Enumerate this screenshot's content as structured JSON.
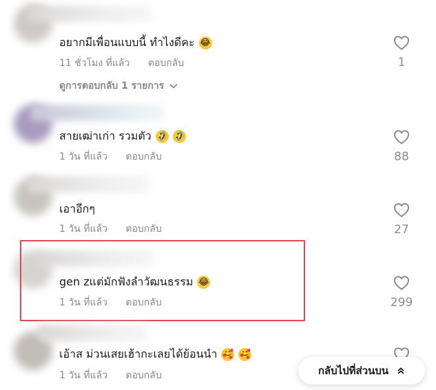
{
  "comments": [
    {
      "text": "อยากมีเพื่อนแบบนี้ ทำไงดีคะ",
      "emojis": [
        "😂"
      ],
      "time": "11 ชั่วโมง ที่แล้ว",
      "reply_label": "ตอบกลับ",
      "likes": "1",
      "view_replies": "ดูการตอบกลับ 1 รายการ"
    },
    {
      "text": "สายเฒ่าเก่า รวมตัว",
      "emojis": [
        "🤣",
        "🤣"
      ],
      "time": "1 วัน ที่แล้ว",
      "reply_label": "ตอบกลับ",
      "likes": "88"
    },
    {
      "text": "เอาอีกๆ",
      "emojis": [],
      "time": "1 วัน ที่แล้ว",
      "reply_label": "ตอบกลับ",
      "likes": "27"
    },
    {
      "text": "gen zแต่มักฟังลำวัฒนธรรม",
      "emojis": [
        "😂"
      ],
      "time": "1 วัน ที่แล้ว",
      "reply_label": "ตอบกลับ",
      "likes": "299"
    },
    {
      "text": "เอ้าส ม่วนเสยเฮ้ากะเลยได้ย้อนนำ",
      "emojis": [
        "🥰",
        "🥰"
      ],
      "time": "1 วัน ที่แล้ว",
      "reply_label": "ตอบกลับ"
    }
  ],
  "back_to_top": {
    "label": "กลับไปที่ส่วนบน",
    "icon": "double-chevron-up-icon"
  },
  "colors": {
    "highlight": "#e5484d",
    "muted_text": "#86878b",
    "primary_text": "#161823"
  }
}
